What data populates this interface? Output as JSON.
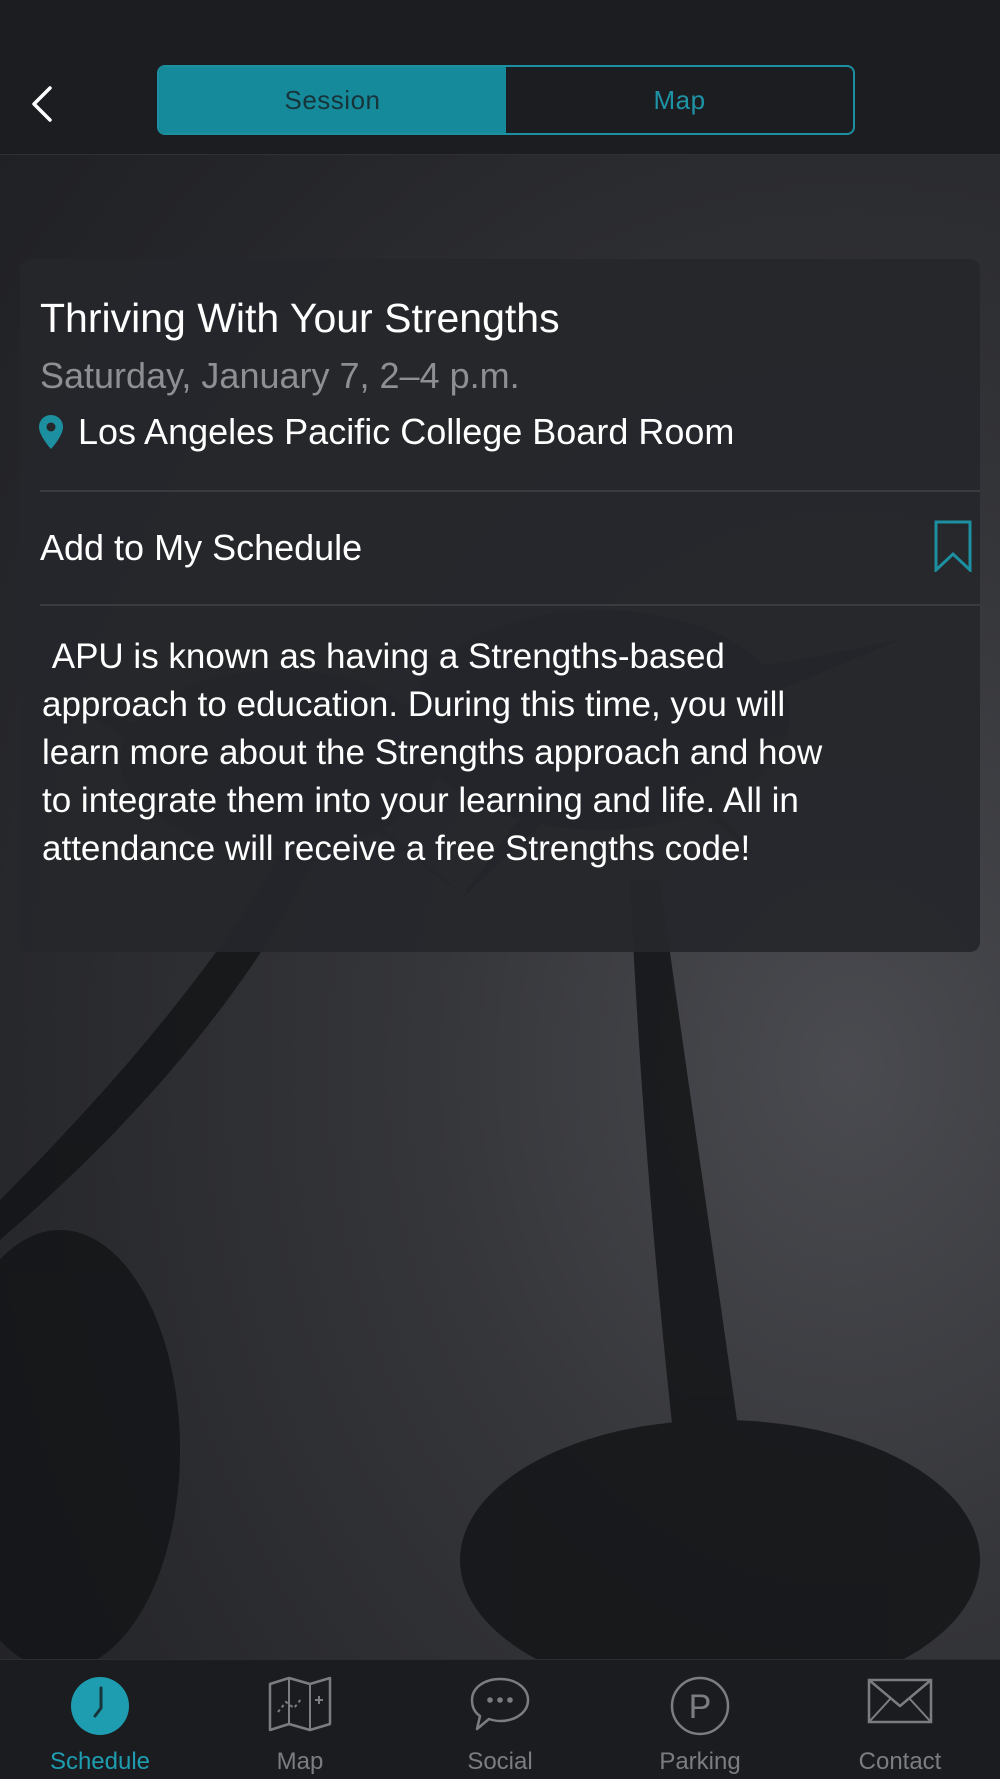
{
  "colors": {
    "accent": "#1c8fa0",
    "background": "#1f2023",
    "card": "#26272b",
    "muted_text": "#8e8f93",
    "tab_inactive": "#7c7d80"
  },
  "header": {
    "back_icon": "chevron-left-icon",
    "segments": [
      {
        "label": "Session",
        "selected": true
      },
      {
        "label": "Map",
        "selected": false
      }
    ]
  },
  "session": {
    "title": "Thriving With Your Strengths",
    "datetime": "Saturday, January 7, 2–4 p.m.",
    "location_icon": "map-pin-icon",
    "location": "Los Angeles Pacific College Board Room",
    "add_label": "Add to My Schedule",
    "bookmark_icon": "bookmark-icon",
    "description": " APU is known as having a Strengths-based\napproach to education. During this time, you will\nlearn more about the Strengths approach and how\nto integrate them into your learning and life. All in\nattendance will receive a free Strengths code!"
  },
  "tabbar": {
    "tabs": [
      {
        "label": "Schedule",
        "icon": "clock-icon",
        "active": true
      },
      {
        "label": "Map",
        "icon": "folded-map-icon",
        "active": false
      },
      {
        "label": "Social",
        "icon": "chat-bubble-icon",
        "active": false
      },
      {
        "label": "Parking",
        "icon": "parking-icon",
        "active": false
      },
      {
        "label": "Contact",
        "icon": "envelope-icon",
        "active": false
      }
    ]
  }
}
